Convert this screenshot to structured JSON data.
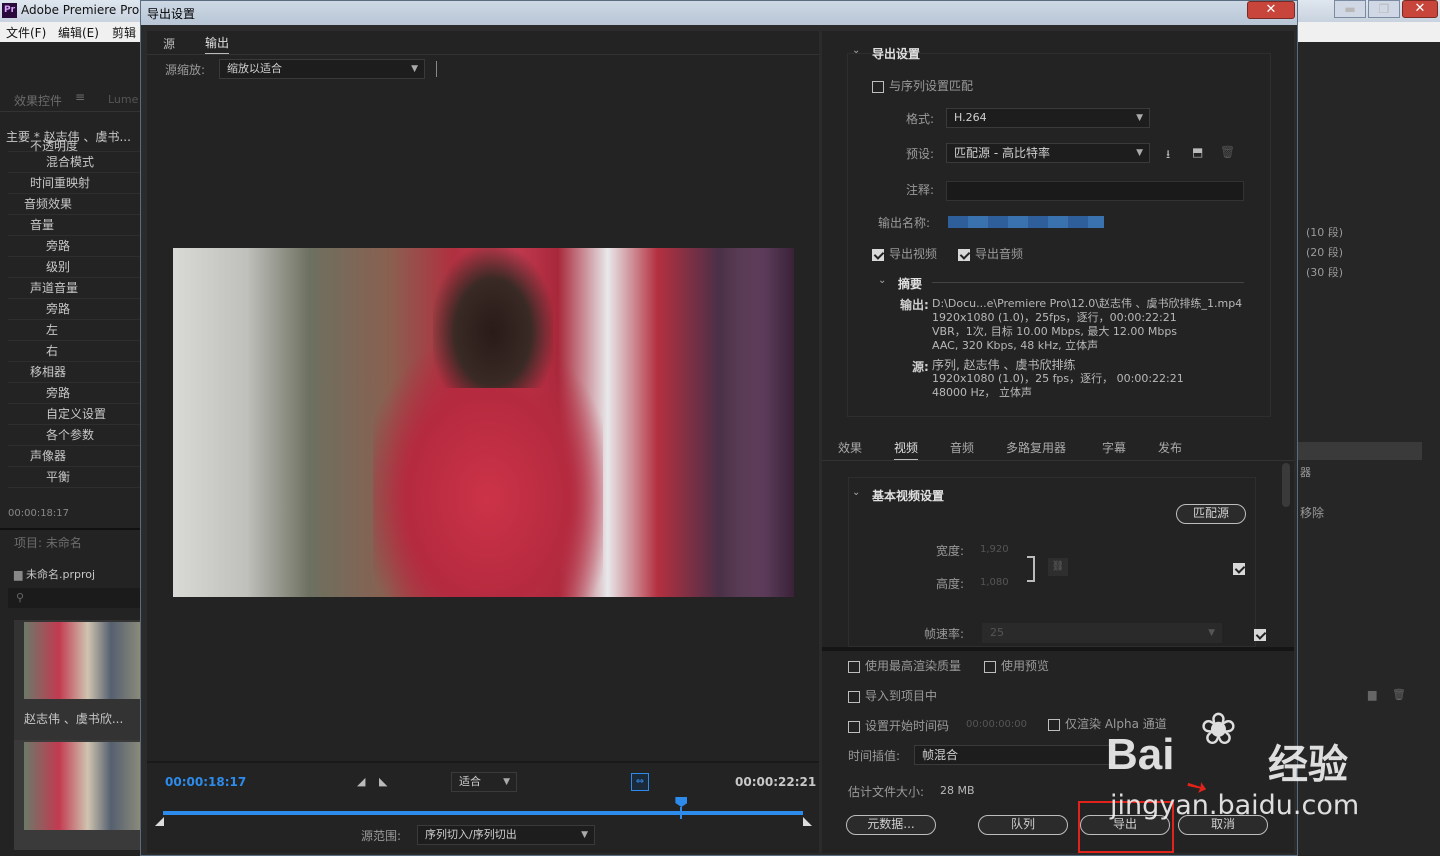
{
  "app": {
    "title": "Adobe Premiere Pro",
    "icon": "Pr",
    "menu": [
      "文件(F)",
      "编辑(E)",
      "剪辑"
    ]
  },
  "left_panel": {
    "tabs": [
      "效果控件",
      "Lume"
    ],
    "clip": "主要 * 赵志伟 、虞书...",
    "rows": [
      "不透明度",
      "混合模式",
      "时间重映射",
      "音频效果",
      "音量",
      "旁路",
      "级别",
      "声道音量",
      "旁路",
      "左",
      "右",
      "移相器",
      "旁路",
      "自定义设置",
      "各个参数",
      "声像器",
      "平衡"
    ],
    "timecode": "00:00:18:17",
    "project_title": "项目: 未命名",
    "project_file": "未命名.prproj",
    "clip_name": "赵志伟 、虞书欣..."
  },
  "right_bg": {
    "items": [
      "(10 段)",
      "(20 段)",
      "(30 段)",
      "器",
      "移除"
    ]
  },
  "dialog": {
    "title": "导出设置",
    "tabs": [
      "源",
      "输出"
    ],
    "source_scale_label": "源缩放:",
    "source_scale_value": "缩放以适合",
    "timeline": {
      "current": "00:00:18:17",
      "end": "00:00:22:21",
      "fit": "适合",
      "range_label": "源范围:",
      "range_value": "序列切入/序列切出",
      "playhead_fraction": 0.81
    },
    "export_settings": {
      "header": "导出设置",
      "match_seq": "与序列设置匹配",
      "format_label": "格式:",
      "format": "H.264",
      "preset_label": "预设:",
      "preset": "匹配源 - 高比特率",
      "comment_label": "注释:",
      "output_name_label": "输出名称:",
      "export_video": "导出视频",
      "export_audio": "导出音频",
      "summary_title": "摘要",
      "output_label": "输出:",
      "output_lines": [
        "D:\\Docu...e\\Premiere Pro\\12.0\\赵志伟 、虞书欣排练_1.mp4",
        "1920x1080 (1.0)，25fps，逐行，00:00:22:21",
        "VBR，1次, 目标 10.00 Mbps, 最大 12.00 Mbps",
        "AAC, 320 Kbps, 48  kHz, 立体声"
      ],
      "source_label": "源:",
      "source_lines": [
        "序列, 赵志伟 、虞书欣排练",
        "1920x1080 (1.0)，25 fps，逐行，   00:00:22:21",
        "48000 Hz，  立体声"
      ]
    },
    "settings_tabs": [
      "效果",
      "视频",
      "音频",
      "多路复用器",
      "字幕",
      "发布"
    ],
    "video": {
      "section": "基本视频设置",
      "match_source": "匹配源",
      "width_label": "宽度:",
      "width": "1,920",
      "height_label": "高度:",
      "height": "1,080",
      "fps_label": "帧速率:",
      "fps": "25"
    },
    "options": {
      "max_quality": "使用最高渲染质量",
      "use_preview": "使用预览",
      "import_project": "导入到项目中",
      "set_start_tc": "设置开始时间码",
      "start_tc": "00:00:00:00",
      "alpha_only": "仅渲染 Alpha 通道",
      "interp_label": "时间插值:",
      "interp_value": "帧混合",
      "filesize_label": "估计文件大小:",
      "filesize": "28 MB"
    },
    "buttons": {
      "metadata": "元数据...",
      "queue": "队列",
      "export": "导出",
      "cancel": "取消"
    }
  },
  "watermark": {
    "brand": "Bai",
    "brand2": "经验",
    "url": "jingyan.baidu.com"
  }
}
